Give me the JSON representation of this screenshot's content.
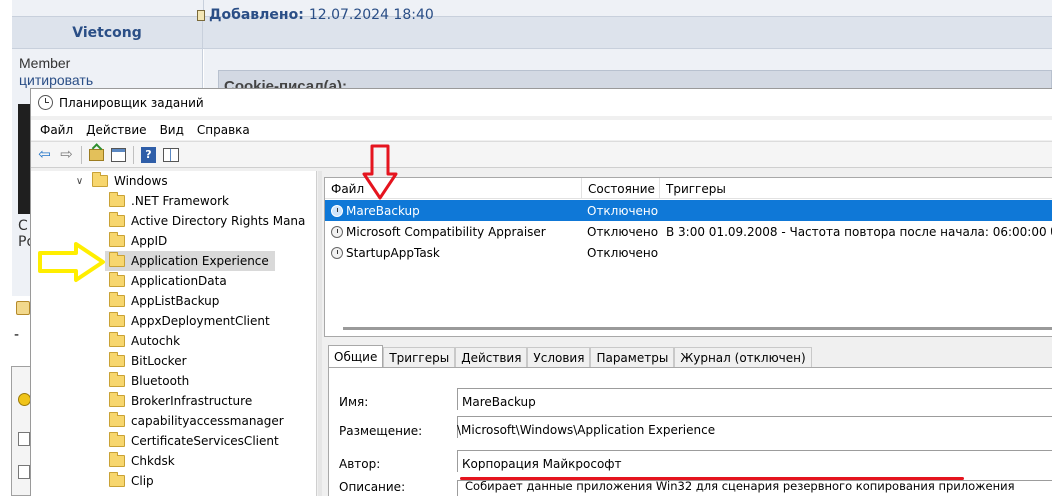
{
  "forum": {
    "author": "Vietcong",
    "posted_label": "Добавлено:",
    "posted_date": "12.07.2024 18:40",
    "member": "Member",
    "quote_link": "цитировать",
    "quote_title": "Cookie-писал(а):",
    "edge_c": "С",
    "edge_p": "Ро",
    "edge_dash": "-"
  },
  "window": {
    "title": "Планировщик заданий",
    "menu": [
      "Файл",
      "Действие",
      "Вид",
      "Справка"
    ]
  },
  "tree": {
    "items": [
      {
        "label": "Windows",
        "level": 0,
        "expanded": true
      },
      {
        "label": ".NET Framework",
        "level": 1
      },
      {
        "label": "Active Directory Rights Mana",
        "level": 1
      },
      {
        "label": "AppID",
        "level": 1
      },
      {
        "label": "Application Experience",
        "level": 1,
        "selected": true
      },
      {
        "label": "ApplicationData",
        "level": 1
      },
      {
        "label": "AppListBackup",
        "level": 1
      },
      {
        "label": "AppxDeploymentClient",
        "level": 1
      },
      {
        "label": "Autochk",
        "level": 1
      },
      {
        "label": "BitLocker",
        "level": 1
      },
      {
        "label": "Bluetooth",
        "level": 1
      },
      {
        "label": "BrokerInfrastructure",
        "level": 1
      },
      {
        "label": "capabilityaccessmanager",
        "level": 1
      },
      {
        "label": "CertificateServicesClient",
        "level": 1
      },
      {
        "label": "Chkdsk",
        "level": 1
      },
      {
        "label": "Clip",
        "level": 1
      }
    ]
  },
  "task_list": {
    "columns": [
      "Файл",
      "Состояние",
      "Триггеры"
    ],
    "rows": [
      {
        "name": "MareBackup",
        "state": "Отключено",
        "trigger": "",
        "selected": true
      },
      {
        "name": "Microsoft Compatibility Appraiser",
        "state": "Отключено",
        "trigger": "В 3:00 01.09.2008 - Частота повтора после начала: 06:00:00 без о"
      },
      {
        "name": "StartupAppTask",
        "state": "Отключено",
        "trigger": ""
      }
    ]
  },
  "details": {
    "tabs": [
      "Общие",
      "Триггеры",
      "Действия",
      "Условия",
      "Параметры",
      "Журнал (отключен)"
    ],
    "active_tab": 0,
    "fields": {
      "name_label": "Имя:",
      "name_value": "MareBackup",
      "location_label": "Размещение:",
      "location_value": "\\Microsoft\\Windows\\Application Experience",
      "author_label": "Автор:",
      "author_value": "Корпорация Майкрософт",
      "description_label": "Описание:",
      "description_value": "Собирает данные приложения Win32 для сценария резервного копирования приложения"
    }
  },
  "annotations": {
    "red_arrow_icon": "down-arrow-icon",
    "yellow_arrow_icon": "right-arrow-icon",
    "red_color": "#e5141e",
    "yellow_color": "#ffee00"
  },
  "colors": {
    "selection": "#0f78d7",
    "forum_accent": "#2a4e86"
  }
}
